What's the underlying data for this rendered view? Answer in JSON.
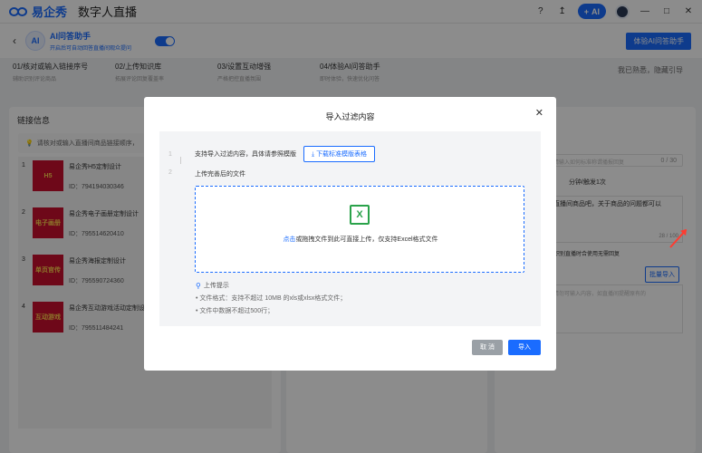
{
  "titlebar": {
    "brand": "易企秀",
    "app_title": "数字人直播",
    "help_icon": "?",
    "upload_icon": "↥",
    "ai_label": "AI",
    "win_min": "—",
    "win_max": "□",
    "win_close": "✕"
  },
  "subbar": {
    "back_icon": "‹",
    "assistant_title": "AI问答助手",
    "assistant_subtitle": "开启后可自动回答直播间观众提问",
    "toggle_on": true,
    "experience_button": "体验AI问答助手"
  },
  "steps": [
    {
      "title": "01/核对或输入链接序号",
      "desc": "辅助识别评论商品"
    },
    {
      "title": "02/上传知识库",
      "desc": "拓展评论回复覆盖率"
    },
    {
      "title": "03/设置互动增强",
      "desc": "严格把控直播氛围"
    },
    {
      "title": "04/体验AI问答助手",
      "desc": "即时体验，快速优化问答"
    }
  ],
  "steps_right": "我已熟悉，隐藏引导",
  "left_panel": {
    "title": "链接信息",
    "tip": "请核对或输入直播间商品链接顺序，",
    "products": [
      {
        "no": "1",
        "img_text": "H5",
        "name": "易企秀H5定制设计",
        "id": "ID：794194030346"
      },
      {
        "no": "2",
        "img_text": "电子画册",
        "name": "易企秀电子画册定制设计",
        "id": "ID：795514620410"
      },
      {
        "no": "3",
        "img_text": "单页官传",
        "name": "易企秀海报定制设计",
        "id": "ID：795590724360"
      },
      {
        "no": "4",
        "img_text": "互动游戏",
        "name": "易企秀互动游戏活动定制设计",
        "id": "ID：795511484241"
      }
    ]
  },
  "right_panel": {
    "input_placeholder": "请输入如何标准称谓播报回复",
    "input_count": "0 / 30",
    "freq_text": "分钟/触发1次",
    "textarea_text": "直播间商品吧，关于商品的问题都可以",
    "textarea_count": "28 / 100",
    "note": "识别直播时合使用无需回复",
    "batch_import": "批量导入",
    "textarea2_placeholder": "请勿可输入内容，如直播间提醒原有的"
  },
  "modal": {
    "title": "导入过滤内容",
    "close_icon": "✕",
    "step1_no": "1",
    "step1_text": "支持导入过滤内容，具体请参照模版",
    "download_button": "下载标准模版表格",
    "step2_no": "2",
    "step2_text": "上传完善后的文件",
    "drop_link": "点击",
    "drop_text": "或拖拽文件到此可直接上传，仅支持Excel格式文件",
    "hint_title": "上传提示",
    "hint_items": [
      "文件格式：支持不超过 10MB 的xls或xlsx格式文件；",
      "文件中数据不超过500行；"
    ],
    "cancel_button": "取 消",
    "ok_button": "导入"
  }
}
